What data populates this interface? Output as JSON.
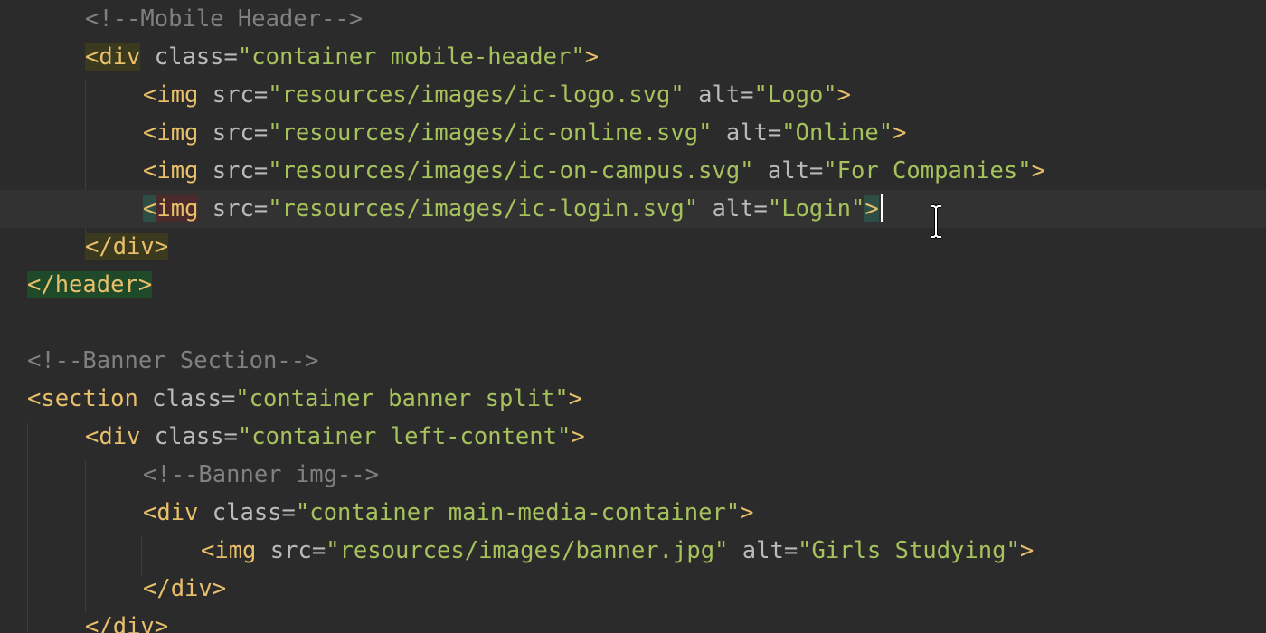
{
  "editor": {
    "lines": [
      {
        "tokens": [
          {
            "t": "<!--Mobile Header-->",
            "c": "c-comment"
          }
        ]
      },
      {
        "tokens": [
          {
            "t": "<div",
            "c": "c-tag",
            "h": "hl-tagpair"
          },
          {
            "t": " class=",
            "c": "c-attr"
          },
          {
            "t": "\"container mobile-header\"",
            "c": "c-val"
          },
          {
            "t": ">",
            "c": "c-tag"
          }
        ]
      },
      {
        "tokens": [
          {
            "t": "<img",
            "c": "c-tag"
          },
          {
            "t": " src=",
            "c": "c-attr"
          },
          {
            "t": "\"resources/images/ic-logo.svg\"",
            "c": "c-val"
          },
          {
            "t": " alt=",
            "c": "c-attr"
          },
          {
            "t": "\"Logo\"",
            "c": "c-val"
          },
          {
            "t": ">",
            "c": "c-tag"
          }
        ]
      },
      {
        "tokens": [
          {
            "t": "<img",
            "c": "c-tag"
          },
          {
            "t": " src=",
            "c": "c-attr"
          },
          {
            "t": "\"resources/images/ic-online.svg\"",
            "c": "c-val"
          },
          {
            "t": " alt=",
            "c": "c-attr"
          },
          {
            "t": "\"Online\"",
            "c": "c-val"
          },
          {
            "t": ">",
            "c": "c-tag"
          }
        ]
      },
      {
        "tokens": [
          {
            "t": "<img",
            "c": "c-tag"
          },
          {
            "t": " src=",
            "c": "c-attr"
          },
          {
            "t": "\"resources/images/ic-on-campus.svg\"",
            "c": "c-val"
          },
          {
            "t": " alt=",
            "c": "c-attr"
          },
          {
            "t": "\"For Companies\"",
            "c": "c-val"
          },
          {
            "t": ">",
            "c": "c-tag"
          }
        ]
      },
      {
        "tokens": [
          {
            "t": "<",
            "c": "c-tag",
            "h": "hl-lt"
          },
          {
            "t": "img",
            "c": "c-tag",
            "h": "hl-img"
          },
          {
            "t": " src=",
            "c": "c-attr"
          },
          {
            "t": "\"resources/images/ic-login.svg\"",
            "c": "c-val"
          },
          {
            "t": " alt=",
            "c": "c-attr"
          },
          {
            "t": "\"Login\"",
            "c": "c-val"
          },
          {
            "t": ">",
            "c": "c-tag",
            "h": "hl-gt"
          }
        ]
      },
      {
        "tokens": [
          {
            "t": "</div>",
            "c": "c-tag",
            "h": "hl-tagpair"
          }
        ]
      },
      {
        "tokens": [
          {
            "t": "</header>",
            "c": "c-tag",
            "h": "hl-closeheader"
          }
        ]
      },
      {
        "tokens": []
      },
      {
        "tokens": [
          {
            "t": "<!--Banner Section-->",
            "c": "c-comment"
          }
        ]
      },
      {
        "tokens": [
          {
            "t": "<section",
            "c": "c-tag"
          },
          {
            "t": " class=",
            "c": "c-attr"
          },
          {
            "t": "\"container banner split\"",
            "c": "c-val"
          },
          {
            "t": ">",
            "c": "c-tag"
          }
        ]
      },
      {
        "tokens": [
          {
            "t": "<div",
            "c": "c-tag"
          },
          {
            "t": " class=",
            "c": "c-attr"
          },
          {
            "t": "\"container left-content\"",
            "c": "c-val"
          },
          {
            "t": ">",
            "c": "c-tag"
          }
        ]
      },
      {
        "tokens": [
          {
            "t": "<!--Banner img-->",
            "c": "c-comment"
          }
        ]
      },
      {
        "tokens": [
          {
            "t": "<div",
            "c": "c-tag"
          },
          {
            "t": " class=",
            "c": "c-attr"
          },
          {
            "t": "\"container main-media-container\"",
            "c": "c-val"
          },
          {
            "t": ">",
            "c": "c-tag"
          }
        ]
      },
      {
        "tokens": [
          {
            "t": "<img",
            "c": "c-tag"
          },
          {
            "t": " src=",
            "c": "c-attr"
          },
          {
            "t": "\"resources/images/banner.jpg\"",
            "c": "c-val"
          },
          {
            "t": " alt=",
            "c": "c-attr"
          },
          {
            "t": "\"Girls Studying\"",
            "c": "c-val"
          },
          {
            "t": ">",
            "c": "c-tag"
          }
        ]
      },
      {
        "tokens": [
          {
            "t": "</div>",
            "c": "c-tag"
          }
        ]
      },
      {
        "tokens": [
          {
            "t": "</div>",
            "c": "c-tag"
          }
        ]
      }
    ]
  },
  "colors": {
    "background": "#2b2b2b",
    "current_line": "#323232",
    "comment": "#808080",
    "tag": "#e8bf6a",
    "attribute": "#bababa",
    "value": "#a5c25c"
  },
  "icons": {
    "cursor": "i-beam-cursor-icon"
  }
}
